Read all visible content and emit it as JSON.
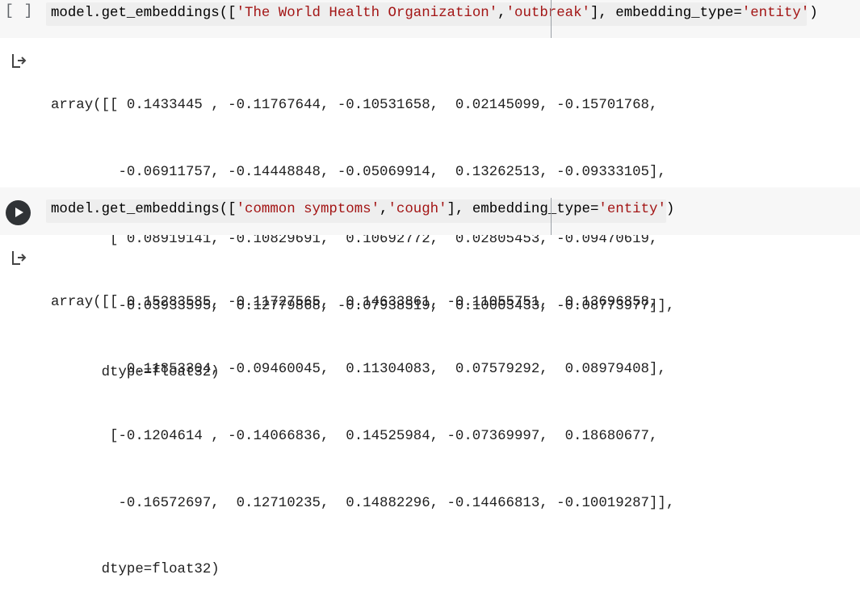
{
  "cells": [
    {
      "run_indicator": "[ ]",
      "code": {
        "prefix": "model.get_embeddings([",
        "s1": "'The World Health Organization'",
        "comma": ",",
        "s2": "'outbreak'",
        "mid": "], embedding_type=",
        "s3": "'entity'",
        "suffix": ")"
      },
      "output_lines": [
        "array([[ 0.1433445 , -0.11767644, -0.10531658,  0.02145099, -0.15701768,",
        "        -0.06911757, -0.14448848, -0.05069914,  0.13262513, -0.09333105],",
        "       [ 0.08919141, -0.10829691,  0.10692772,  0.02805453, -0.09470619,",
        "        -0.03933595,  0.12779868, -0.07938519,  0.10003433, -0.08773977]],",
        "      dtype=float32)"
      ]
    },
    {
      "run_indicator": "play",
      "code": {
        "prefix": "model.get_embeddings([",
        "s1": "'common symptoms'",
        "comma": ",",
        "s2": "'cough'",
        "mid": "], embedding_type=",
        "s3": "'entity'",
        "suffix": ")"
      },
      "output_lines": [
        "array([[ 0.15283585, -0.11727565,  0.14633861, -0.11055751,  0.13696858,",
        "         0.11853304, -0.09460045,  0.11304083,  0.07579292,  0.08979408],",
        "       [-0.1204614 , -0.14066836,  0.14525984, -0.07369997,  0.18680677,",
        "        -0.16572697,  0.12710235,  0.14882296, -0.14466813, -0.10019287]],",
        "      dtype=float32)"
      ]
    }
  ],
  "icons": {
    "run_play": "play-icon",
    "output": "output-arrow-icon"
  },
  "colors": {
    "string": "#a31515",
    "cell_bg": "#f7f7f7",
    "play_button": "#303336"
  }
}
